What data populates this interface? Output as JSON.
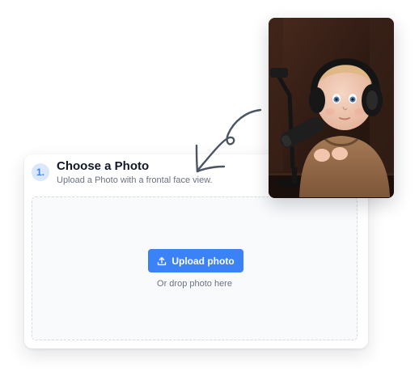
{
  "step": {
    "number": "1.",
    "title": "Choose a Photo",
    "subtitle": "Upload a Photo with a frontal face view."
  },
  "dropzone": {
    "upload_button_label": "Upload photo",
    "upload_icon": "upload-icon",
    "hint": "Or drop photo here"
  },
  "example_photo": {
    "icon": "example-photo-baby-headphones-microphone"
  },
  "decor": {
    "arrow_icon": "hand-drawn-arrow-icon"
  },
  "colors": {
    "accent": "#3b82f6",
    "badge_bg": "#dbe7fb",
    "title": "#111827",
    "muted": "#6b7280",
    "dropzone_bg": "#f8fafc"
  }
}
